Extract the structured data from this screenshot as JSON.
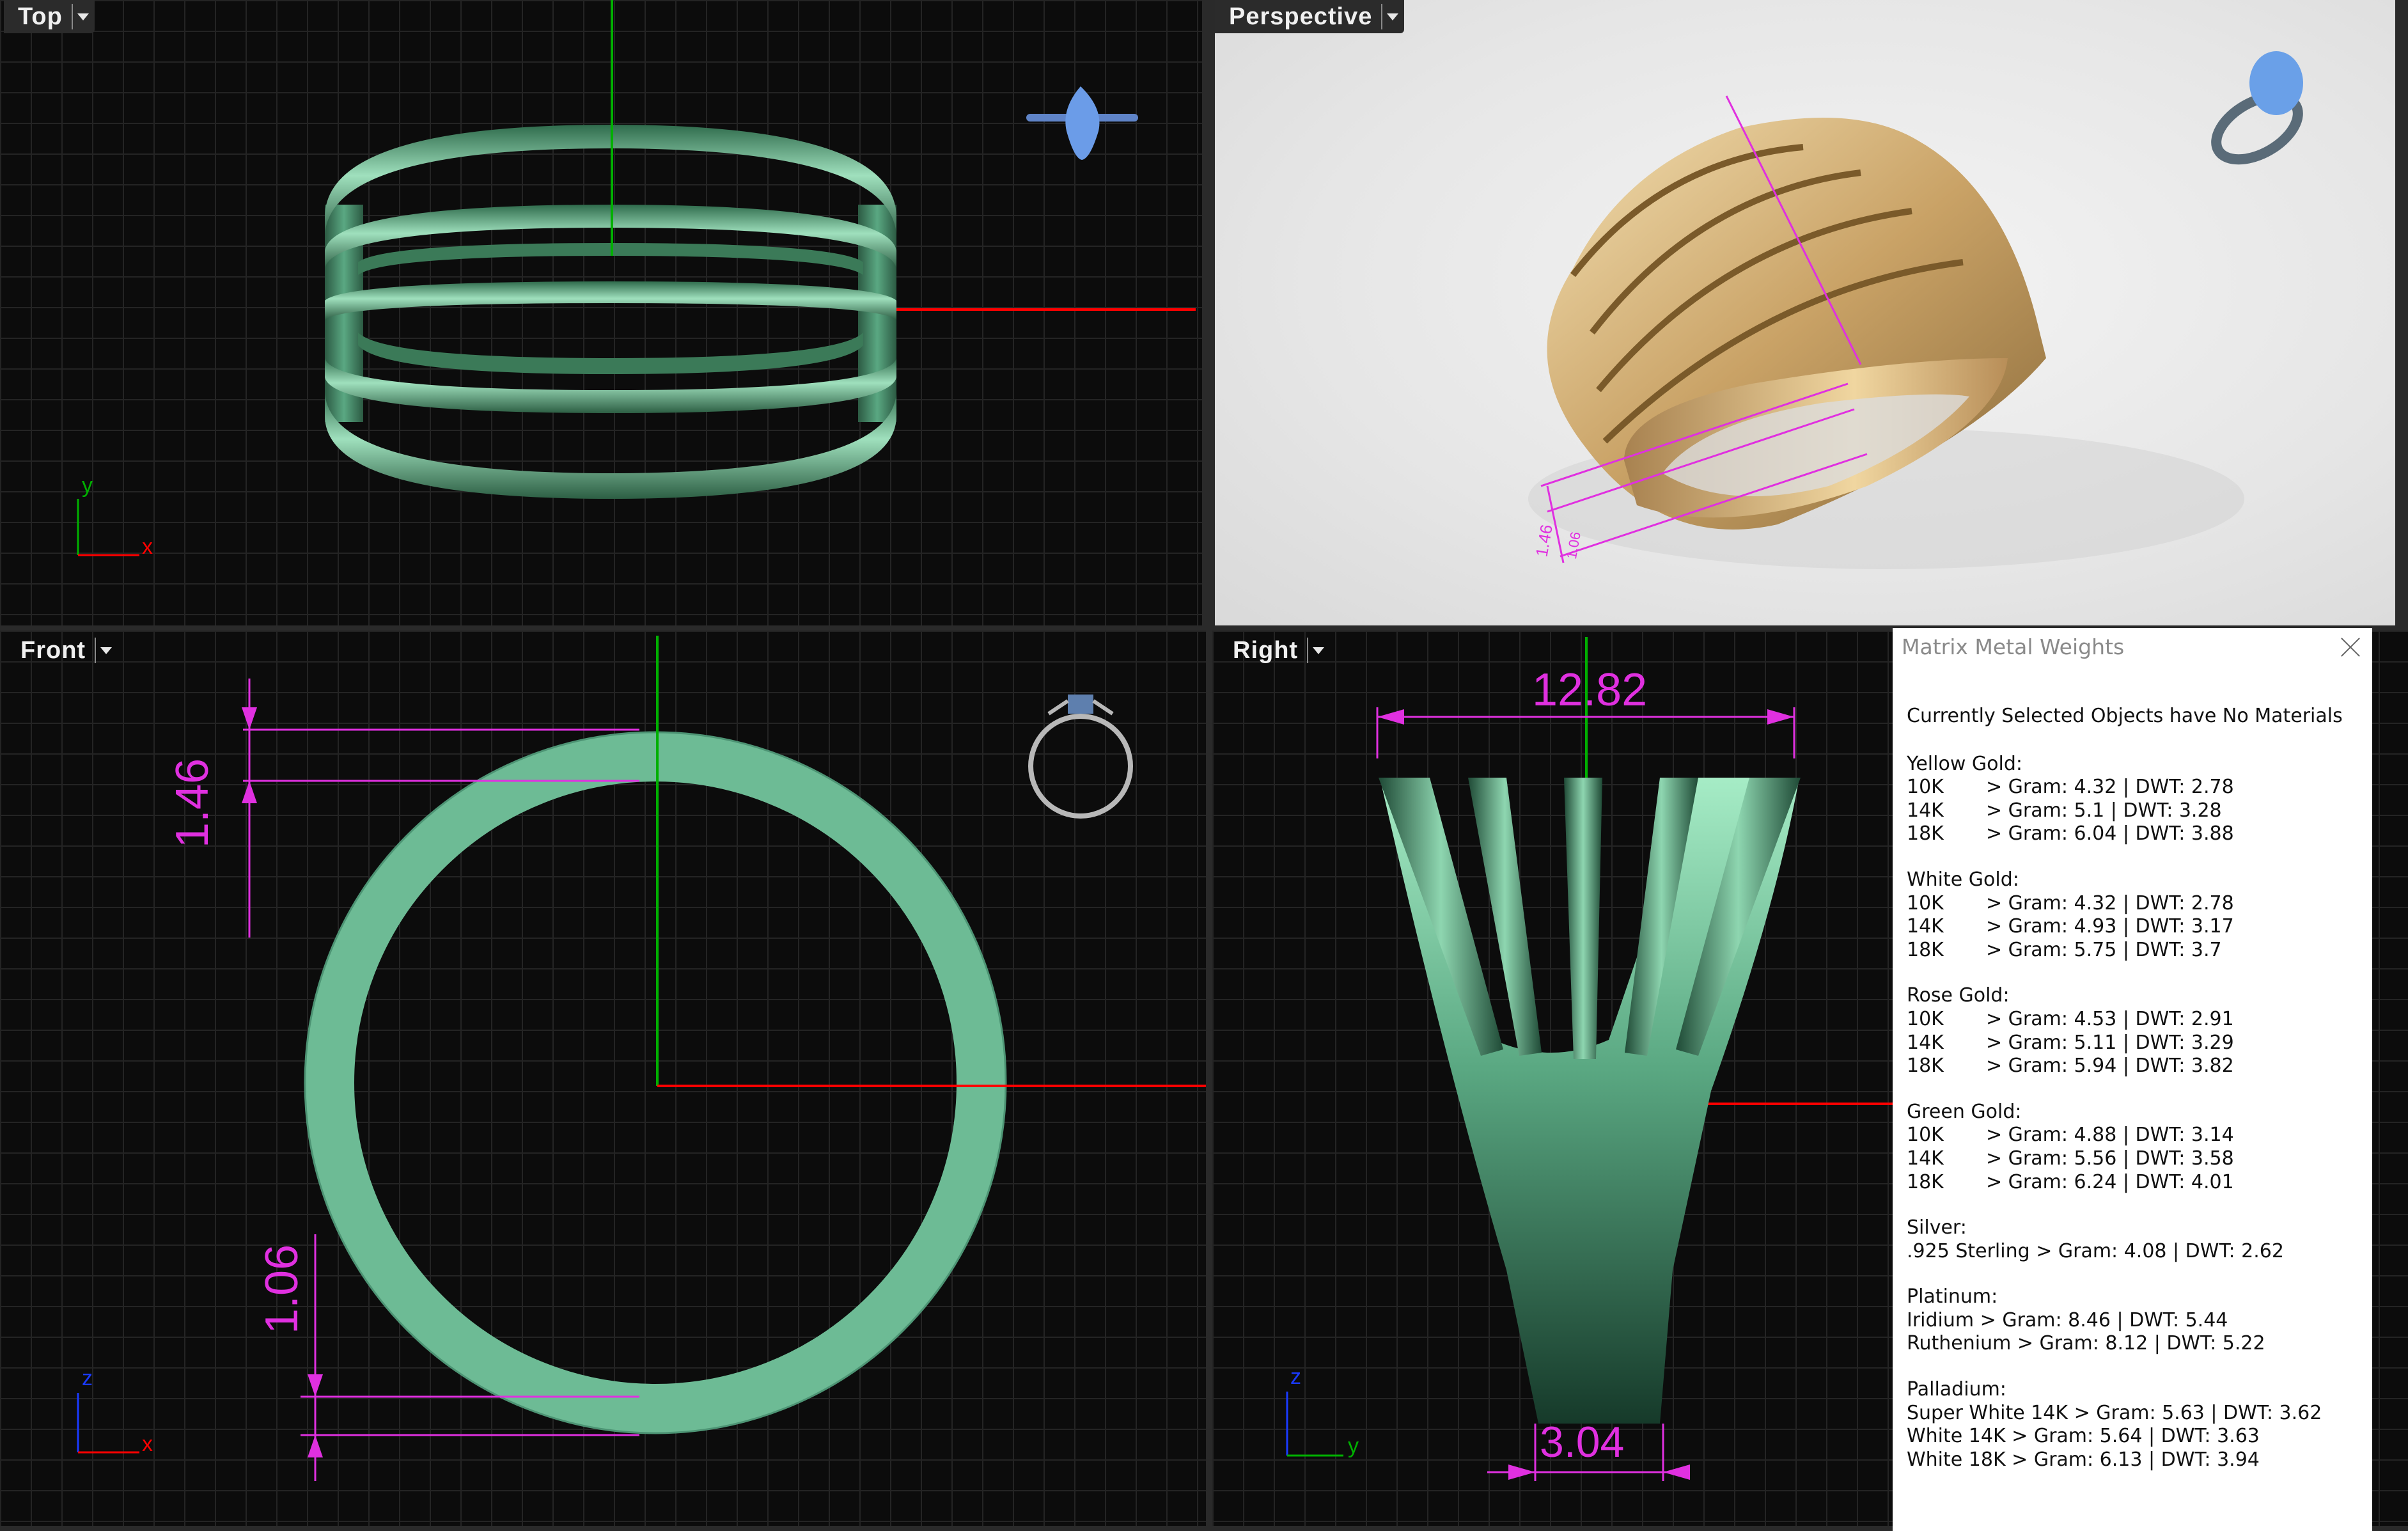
{
  "viewports": {
    "top": {
      "title": "Top",
      "axis_x": "x",
      "axis_y": "y"
    },
    "perspective": {
      "title": "Perspective",
      "dims": [
        "1.46",
        "1.06"
      ]
    },
    "front": {
      "title": "Front",
      "dim_top": "1.46",
      "dim_bottom": "1.06",
      "axis_x": "x",
      "axis_z": "z"
    },
    "right": {
      "title": "Right",
      "dim_top": "12.82",
      "dim_bottom": "3.04",
      "axis_y": "y",
      "axis_z": "z"
    }
  },
  "panel": {
    "title": "Matrix Metal Weights",
    "status": "Currently Selected Objects have No Materials",
    "groups": [
      {
        "name": "Yellow Gold:",
        "rows": [
          {
            "k": "10K",
            "v": "> Gram: 4.32 | DWT: 2.78"
          },
          {
            "k": "14K",
            "v": "> Gram: 5.1 | DWT: 3.28"
          },
          {
            "k": "18K",
            "v": "> Gram: 6.04 | DWT: 3.88"
          }
        ]
      },
      {
        "name": "White Gold:",
        "rows": [
          {
            "k": "10K",
            "v": "> Gram: 4.32 | DWT: 2.78"
          },
          {
            "k": "14K",
            "v": "> Gram: 4.93 | DWT: 3.17"
          },
          {
            "k": "18K",
            "v": "> Gram: 5.75 | DWT: 3.7"
          }
        ]
      },
      {
        "name": "Rose Gold:",
        "rows": [
          {
            "k": "10K",
            "v": "> Gram: 4.53 | DWT: 2.91"
          },
          {
            "k": "14K",
            "v": "> Gram: 5.11 | DWT: 3.29"
          },
          {
            "k": "18K",
            "v": "> Gram: 5.94 | DWT: 3.82"
          }
        ]
      },
      {
        "name": "Green Gold:",
        "rows": [
          {
            "k": "10K",
            "v": "> Gram: 4.88 | DWT: 3.14"
          },
          {
            "k": "14K",
            "v": "> Gram: 5.56 | DWT: 3.58"
          },
          {
            "k": "18K",
            "v": "> Gram: 6.24 | DWT: 4.01"
          }
        ]
      },
      {
        "name": "Silver:",
        "lines": [
          ".925 Sterling > Gram: 4.08 | DWT: 2.62"
        ]
      },
      {
        "name": "Platinum:",
        "lines": [
          "Iridium > Gram: 8.46 | DWT: 5.44",
          "Ruthenium > Gram: 8.12 | DWT: 5.22"
        ]
      },
      {
        "name": "Palladium:",
        "lines": [
          "Super White 14K > Gram: 5.63 | DWT: 3.62",
          "White 14K > Gram: 5.64 | DWT: 3.63",
          "White 18K > Gram: 6.13 | DWT: 3.94"
        ]
      }
    ]
  },
  "colors": {
    "ring_green": "#5fb48a",
    "dimension_magenta": "#e030e0",
    "axis_red": "#ff0000",
    "axis_green": "#00b000",
    "gold": "#d8b880"
  }
}
